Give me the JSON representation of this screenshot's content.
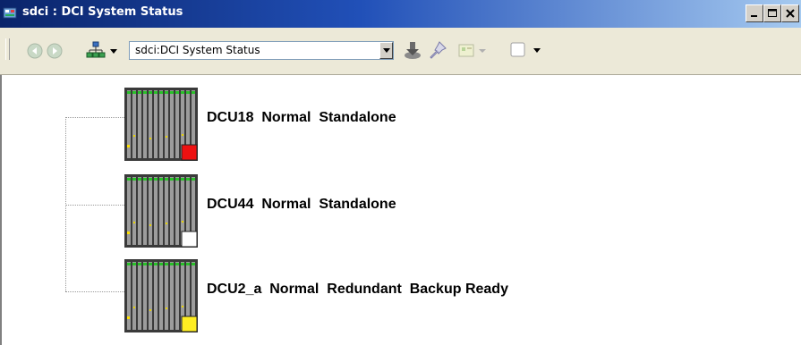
{
  "window": {
    "title": "sdci : DCI System Status",
    "icon": "app-icon",
    "controls": {
      "minimize_icon": "minimize-icon",
      "maximize_icon": "maximize-icon",
      "close_icon": "close-icon"
    }
  },
  "toolbar": {
    "back_icon": "back-icon",
    "forward_icon": "forward-icon",
    "hierarchy_icon": "hierarchy-icon",
    "address_value": "sdci:DCI System Status",
    "download_icon": "download-icon",
    "pin_icon": "pin-icon",
    "view_icon": "view-icon",
    "page_icon": "page-icon"
  },
  "nodes": [
    {
      "label": "DCU18  Normal  Standalone",
      "status_color": "#ee1111"
    },
    {
      "label": "DCU44  Normal  Standalone",
      "status_color": "#ffffff"
    },
    {
      "label": "DCU2_a  Normal  Redundant  Backup Ready",
      "status_color": "#ffee22"
    }
  ]
}
